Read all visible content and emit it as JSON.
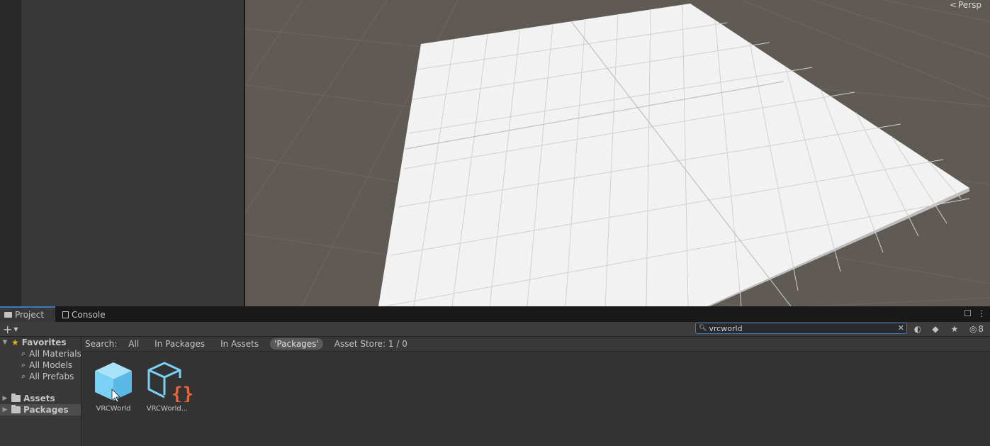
{
  "scene": {
    "camera_mode": "Persp"
  },
  "panel": {
    "tabs": [
      {
        "label": "Project"
      },
      {
        "label": "Console"
      }
    ],
    "search": {
      "value": "vrcworld",
      "hidden_count": "8"
    }
  },
  "sidebar": {
    "favorites": {
      "label": "Favorites",
      "items": [
        {
          "label": "All Materials"
        },
        {
          "label": "All Models"
        },
        {
          "label": "All Prefabs"
        }
      ]
    },
    "roots": [
      {
        "label": "Assets"
      },
      {
        "label": "Packages"
      }
    ]
  },
  "filter_bar": {
    "search_label": "Search:",
    "options": [
      {
        "label": "All"
      },
      {
        "label": "In Packages"
      },
      {
        "label": "In Assets"
      },
      {
        "label": "'Packages'"
      }
    ],
    "asset_store": "Asset Store: 1 / 0"
  },
  "assets": [
    {
      "label": "VRCWorld",
      "icon": "prefab-cube-icon"
    },
    {
      "label": "VRCWorld...",
      "icon": "script-cube-icon"
    }
  ],
  "colors": {
    "accent": "#3a79bb",
    "prefab_blue": "#7ad0f5",
    "script_orange": "#e8643c"
  }
}
